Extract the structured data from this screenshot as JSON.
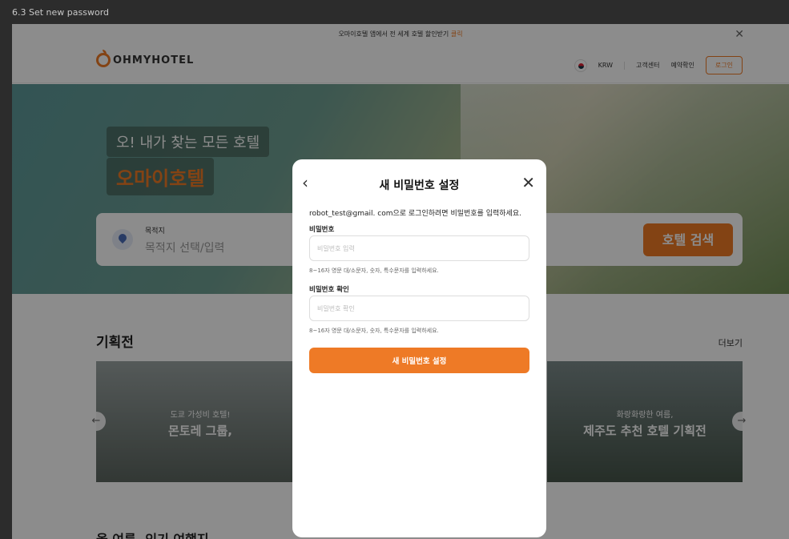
{
  "window": {
    "title": "6.3 Set new password"
  },
  "promo": {
    "text": "오마이호텔 앱에서 전 세계 호텔 할인받기",
    "highlight": "클릭"
  },
  "header": {
    "logo": "OHMYHOTEL",
    "currency": "KRW",
    "customer_center": "고객센터",
    "reservation_check": "예약확인",
    "login": "로그인"
  },
  "hero": {
    "tagline": "오! 내가 찾는 모든 호텔",
    "brand": "오마이호텔",
    "destination_label": "목적지",
    "destination_placeholder": "목적지 선택/입력",
    "search_button": "호텔 검색"
  },
  "section": {
    "title": "기획전",
    "more": "더보기",
    "cards": [
      {
        "line1": "도쿄 가성비 호텔!",
        "line2": "몬토레 그룹,"
      },
      {
        "line1": "화랑화랑한 여름,",
        "line2": "제주도 추천 호텔 기획전"
      }
    ],
    "next_title": "올 여름, 인기 여행지"
  },
  "modal": {
    "title": "새 비밀번호 설정",
    "description": "robot_test@gmail. com으로 로그인하려면 비밀번호를 입력하세요.",
    "password_label": "비밀번호",
    "password_placeholder": "비밀번호 입력",
    "password_hint": "8~16자 영문 대/소문자, 숫자, 특수문자를 입력하세요.",
    "confirm_label": "비밀번호 확인",
    "confirm_placeholder": "비밀번호 확인",
    "confirm_hint": "8~16자 영문 대/소문자, 숫자, 특수문자를 입력하세요.",
    "submit": "새 비밀번호 설정"
  },
  "colors": {
    "accent": "#ee7a26",
    "backdrop": "#2c2c2c"
  }
}
